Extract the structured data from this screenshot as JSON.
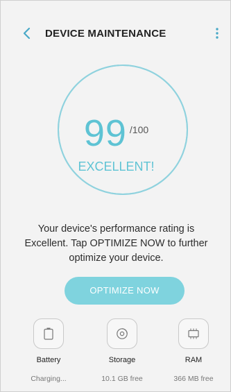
{
  "header": {
    "title": "DEVICE MAINTENANCE",
    "back_icon": "chevron-left-icon",
    "menu_icon": "more-vert-icon"
  },
  "score": {
    "value": "99",
    "max": "/100",
    "rating": "EXCELLENT!",
    "progress": 0.99
  },
  "description": "Your device's performance rating is Excellent. Tap OPTIMIZE NOW to further optimize your device.",
  "optimize_button": {
    "label": "OPTIMIZE NOW"
  },
  "items": [
    {
      "label": "Battery",
      "status": "Charging...",
      "icon": "battery-icon"
    },
    {
      "label": "Storage",
      "status": "10.1 GB free",
      "icon": "storage-icon"
    },
    {
      "label": "RAM",
      "status": "366 MB free",
      "icon": "ram-chip-icon"
    }
  ],
  "colors": {
    "accent": "#5ec3d4",
    "button": "#7fd3de",
    "background": "#f3f3f3"
  }
}
